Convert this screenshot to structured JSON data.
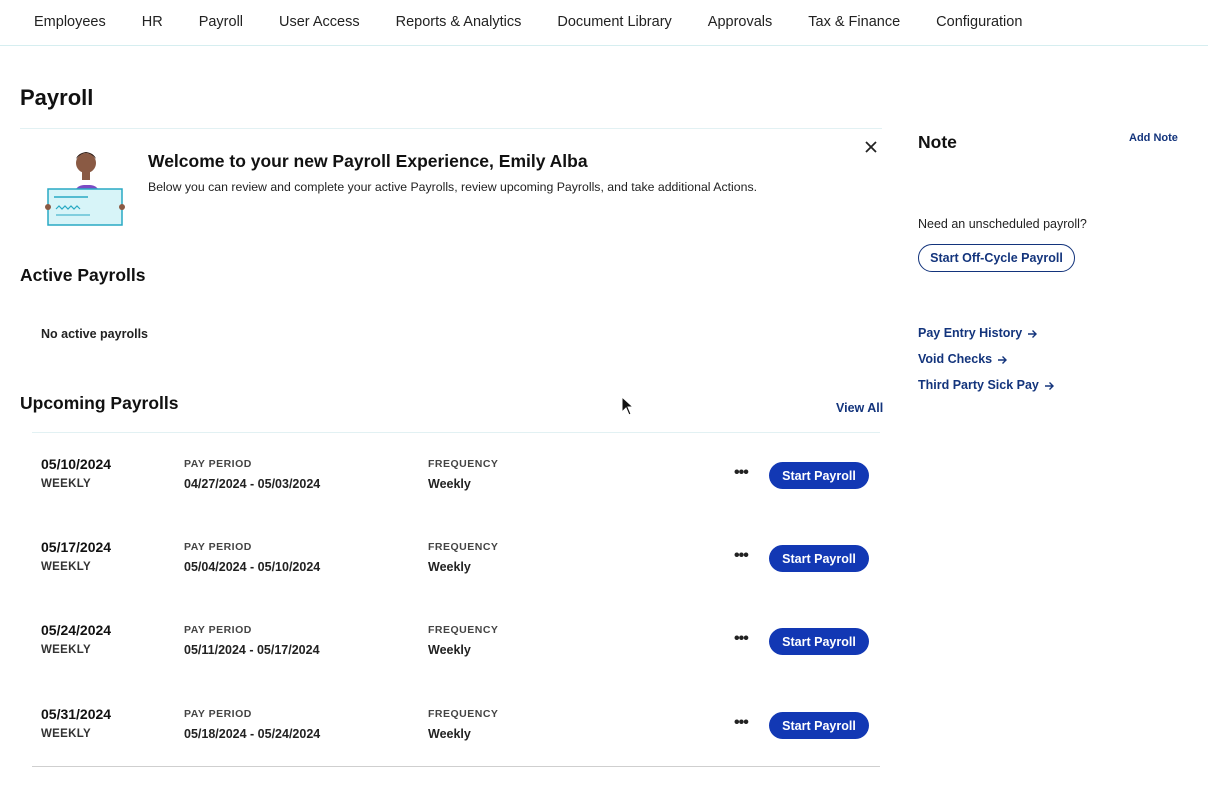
{
  "nav": {
    "items": [
      "Employees",
      "HR",
      "Payroll",
      "User Access",
      "Reports & Analytics",
      "Document Library",
      "Approvals",
      "Tax & Finance",
      "Configuration"
    ]
  },
  "page": {
    "title": "Payroll"
  },
  "welcome": {
    "title": "Welcome to your new Payroll Experience, Emily Alba",
    "subtitle": "Below you can review and complete your active Payrolls, review upcoming Payrolls, and take additional Actions.",
    "illustration_icon": "person-holding-check-icon",
    "close_icon": "close-icon"
  },
  "active": {
    "title": "Active Payrolls",
    "empty_text": "No active payrolls"
  },
  "upcoming": {
    "title": "Upcoming Payrolls",
    "view_all": "View All",
    "pay_period_label": "PAY PERIOD",
    "frequency_label": "FREQUENCY",
    "more_label": "•••",
    "start_label": "Start Payroll",
    "rows": [
      {
        "date": "05/10/2024",
        "freq_small": "WEEKLY",
        "period": "04/27/2024 - 05/03/2024",
        "frequency": "Weekly"
      },
      {
        "date": "05/17/2024",
        "freq_small": "WEEKLY",
        "period": "05/04/2024 - 05/10/2024",
        "frequency": "Weekly"
      },
      {
        "date": "05/24/2024",
        "freq_small": "WEEKLY",
        "period": "05/11/2024 - 05/17/2024",
        "frequency": "Weekly"
      },
      {
        "date": "05/31/2024",
        "freq_small": "WEEKLY",
        "period": "05/18/2024 - 05/24/2024",
        "frequency": "Weekly"
      }
    ]
  },
  "note": {
    "title": "Note",
    "add_note": "Add Note",
    "unscheduled_text": "Need an unscheduled payroll?",
    "offcycle_button": "Start Off-Cycle Payroll",
    "links": [
      "Pay Entry History",
      "Void Checks",
      "Third Party Sick Pay"
    ]
  },
  "colors": {
    "primary": "#1238b4",
    "link": "#13347c",
    "divider": "#e2f1f3"
  }
}
